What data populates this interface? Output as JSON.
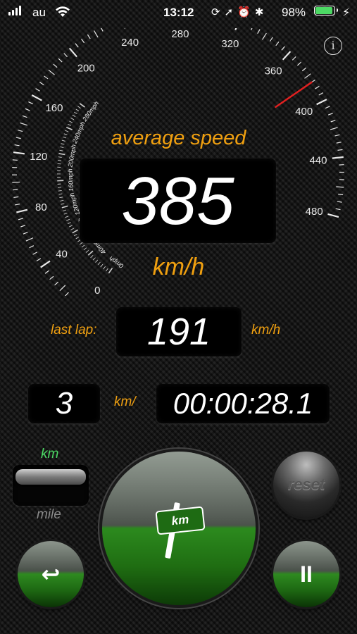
{
  "status_bar": {
    "carrier": "au",
    "time": "13:12",
    "battery_percent": "98%",
    "battery_level": 0.98,
    "icons": [
      "signal-icon",
      "wifi-icon",
      "rotation-lock-icon",
      "location-icon",
      "alarm-icon",
      "bluetooth-icon",
      "charging-icon"
    ]
  },
  "info_button": {
    "label": "i"
  },
  "gauge": {
    "outer_ticks": [
      "0",
      "40",
      "80",
      "120",
      "160",
      "200",
      "240",
      "280",
      "320",
      "360",
      "400",
      "440",
      "480"
    ],
    "inner_ticks": [
      "0mph",
      "40mph",
      "80mph",
      "120mph",
      "160mph",
      "200mph",
      "240mph",
      "280mph"
    ],
    "needle_value": 385,
    "max_value": 480,
    "needle_color": "#e02020"
  },
  "average": {
    "title": "average speed",
    "value": "385",
    "unit": "km/h"
  },
  "last_lap": {
    "label": "last lap:",
    "value": "191",
    "unit": "km/h"
  },
  "distance": {
    "value": "3",
    "unit": "km/"
  },
  "timer": {
    "value": "00:00:28.1"
  },
  "unit_switch": {
    "option_top": "km",
    "option_bottom": "mile",
    "selected": "km"
  },
  "lap_button": {
    "label": "km"
  },
  "reset_button": {
    "label": "reset"
  },
  "back_button": {
    "symbol": "↩"
  },
  "pause_button": {
    "symbol": "II"
  },
  "colors": {
    "accent": "#f0a010",
    "green": "#4cd964",
    "button_green": "#1f6d12"
  }
}
